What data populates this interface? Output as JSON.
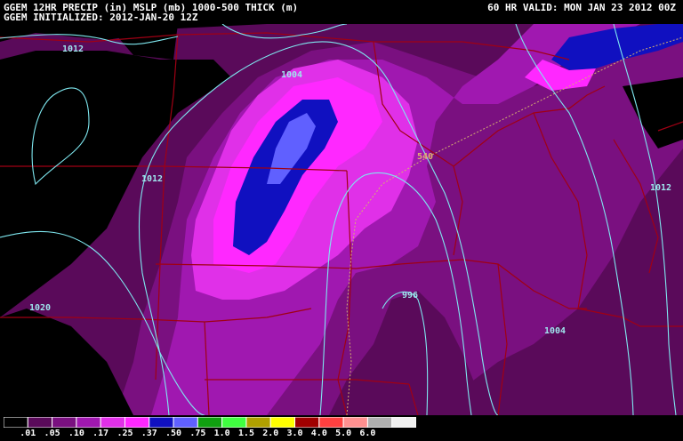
{
  "header": {
    "title": "GGEM 12HR PRECIP (in) MSLP (mb) 1000-500 THICK (m)",
    "initialized": "GGEM INITIALIZED: 2012-JAN-20 12Z",
    "valid": "60 HR VALID: MON JAN 23 2012 00Z"
  },
  "isobar_labels": [
    "1012",
    "1004",
    "1012",
    "1020",
    "996",
    "1004",
    "1012"
  ],
  "thickness_label": "540",
  "legend": {
    "ticks": [
      ".01",
      ".05",
      ".10",
      ".17",
      ".25",
      ".37",
      ".50",
      ".75",
      "1.0",
      "1.5",
      "2.0",
      "3.0",
      "4.0",
      "5.0",
      "6.0"
    ],
    "colors": [
      "#000000",
      "#5a0a5a",
      "#7a1080",
      "#a018b0",
      "#e030e8",
      "#ff28ff",
      "#1010c0",
      "#6060ff",
      "#10a010",
      "#40ff40",
      "#b0a000",
      "#ffff00",
      "#a00000",
      "#ff4040",
      "#ff9090",
      "#b0b0b0",
      "#f0f0f0"
    ]
  },
  "colors": {
    "precip_light": "#5a0a5a",
    "precip_mid": "#7a1080",
    "precip_med": "#a018b0",
    "precip_heavy": "#e030e8",
    "precip_heavier": "#ff28ff",
    "precip_blue": "#1010c0",
    "precip_lightblue": "#6060ff",
    "isobar": "#7fe8f0",
    "border": "#a00014"
  }
}
